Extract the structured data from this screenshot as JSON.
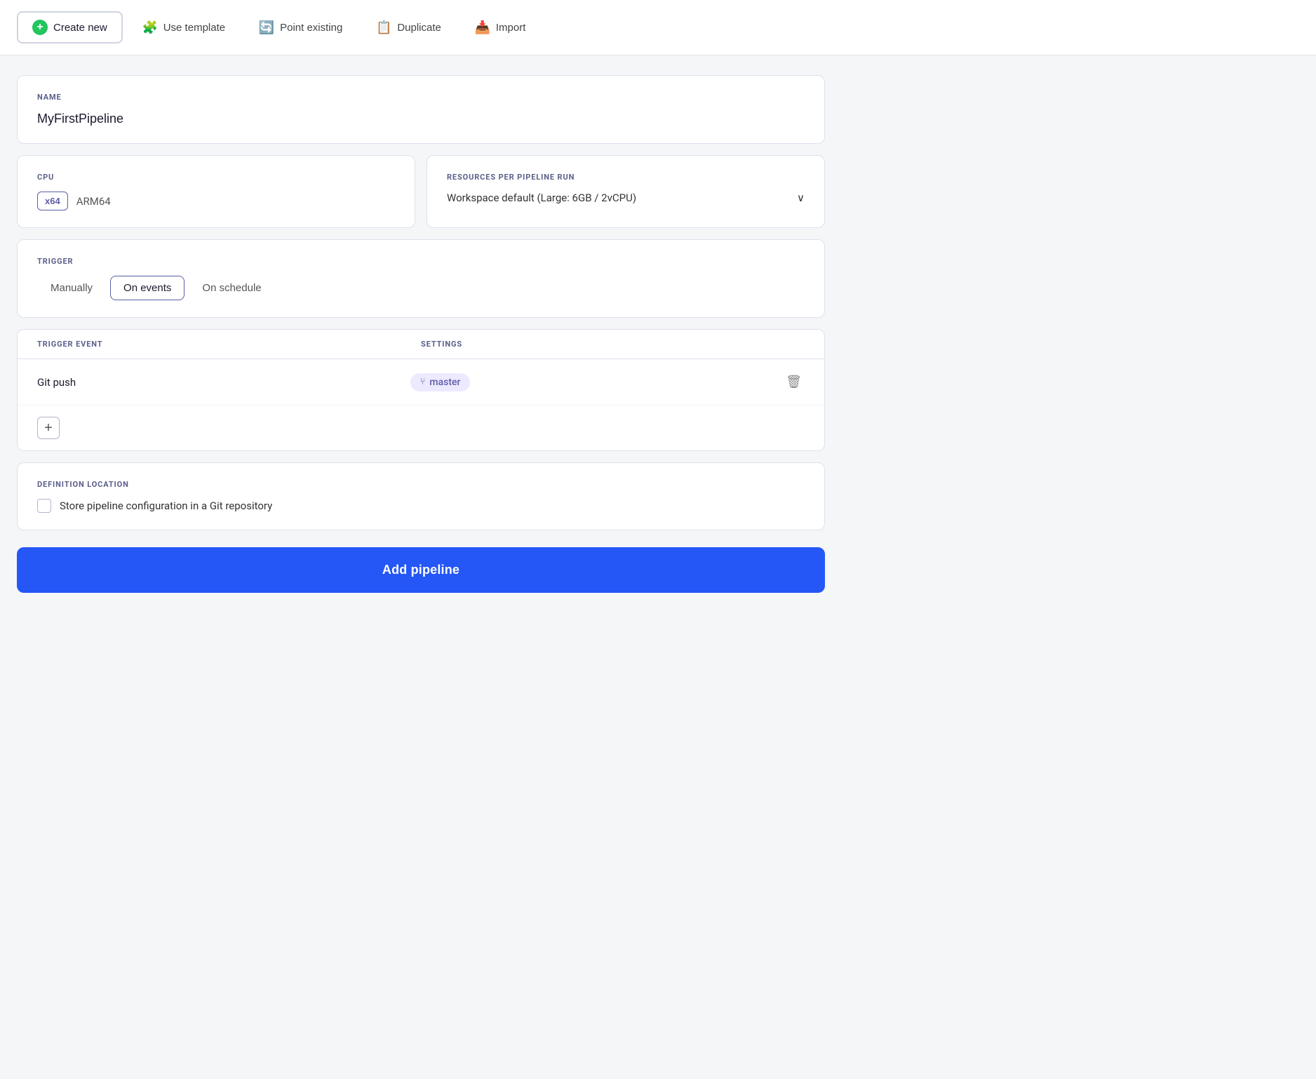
{
  "tabs": [
    {
      "id": "create-new",
      "label": "Create new",
      "icon": "➕",
      "iconType": "circle-plus",
      "active": true
    },
    {
      "id": "use-template",
      "label": "Use template",
      "icon": "🧩",
      "iconType": "template",
      "active": false
    },
    {
      "id": "point-existing",
      "label": "Point existing",
      "icon": "🔄",
      "iconType": "point",
      "active": false
    },
    {
      "id": "duplicate",
      "label": "Duplicate",
      "icon": "📋",
      "iconType": "duplicate",
      "active": false
    },
    {
      "id": "import",
      "label": "Import",
      "icon": "📥",
      "iconType": "import",
      "active": false
    }
  ],
  "name_section": {
    "label": "NAME",
    "value": "MyFirstPipeline",
    "placeholder": "Pipeline name"
  },
  "cpu_section": {
    "label": "CPU",
    "options": [
      {
        "id": "x64",
        "label": "x64",
        "active": true
      },
      {
        "id": "arm64",
        "label": "ARM64",
        "active": false
      }
    ]
  },
  "resources_section": {
    "label": "RESOURCES PER PIPELINE RUN",
    "value": "Workspace default (Large: 6GB / 2vCPU)"
  },
  "trigger_section": {
    "label": "TRIGGER",
    "options": [
      {
        "id": "manually",
        "label": "Manually",
        "active": false
      },
      {
        "id": "on-events",
        "label": "On events",
        "active": true
      },
      {
        "id": "on-schedule",
        "label": "On schedule",
        "active": false
      }
    ]
  },
  "trigger_event_section": {
    "columns": {
      "event": "TRIGGER EVENT",
      "settings": "SETTINGS"
    },
    "rows": [
      {
        "event": "Git push",
        "branch": "master",
        "branch_icon": "⑂"
      }
    ],
    "add_button_label": "+"
  },
  "definition_section": {
    "label": "DEFINITION LOCATION",
    "checkbox_label": "Store pipeline configuration in a Git repository"
  },
  "add_button": {
    "label": "Add pipeline"
  }
}
